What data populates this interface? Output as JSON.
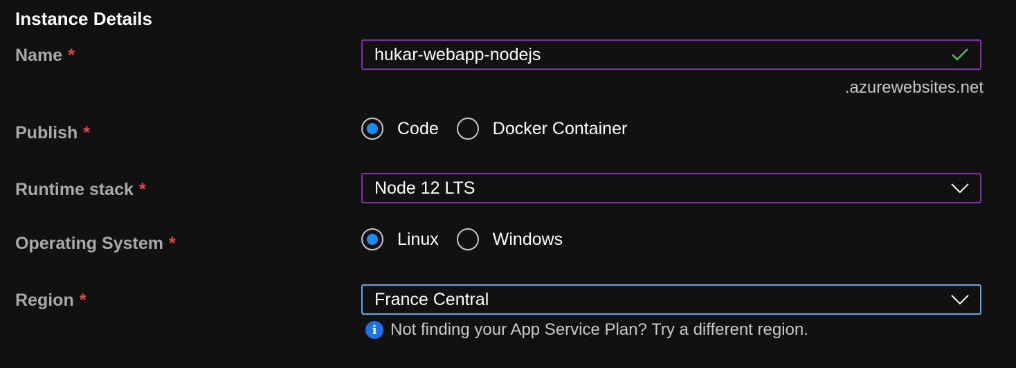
{
  "section": {
    "title": "Instance Details"
  },
  "required_marker": "*",
  "name": {
    "label": "Name",
    "value": "hukar-webapp-nodejs",
    "suffix": ".azurewebsites.net",
    "valid_icon": "checkmark-icon"
  },
  "publish": {
    "label": "Publish",
    "options": [
      {
        "label": "Code",
        "selected": true
      },
      {
        "label": "Docker Container",
        "selected": false
      }
    ]
  },
  "runtime": {
    "label": "Runtime stack",
    "value": "Node 12 LTS"
  },
  "os": {
    "label": "Operating System",
    "options": [
      {
        "label": "Linux",
        "selected": true
      },
      {
        "label": "Windows",
        "selected": false
      }
    ]
  },
  "region": {
    "label": "Region",
    "value": "France Central",
    "hint": "Not finding your App Service Plan? Try a different region."
  },
  "colors": {
    "background": "#111111",
    "field_border": "#8a2da8",
    "field_border_focused": "#5aa9ea",
    "required": "#e8473f",
    "radio_selected": "#1a8cf0",
    "valid": "#5cb85c"
  }
}
